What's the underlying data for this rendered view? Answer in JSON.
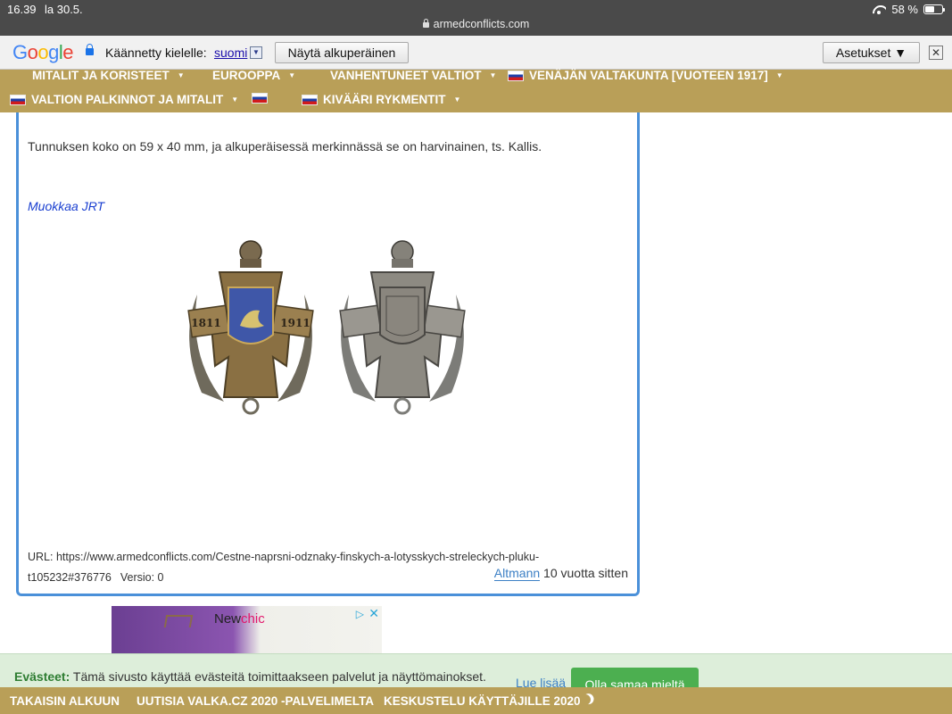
{
  "status_bar": {
    "time": "16.39",
    "date": "la 30.5.",
    "url": "armedconflicts.com",
    "battery_text": "58 %",
    "battery_level": 0.58
  },
  "translate_bar": {
    "logo": "Google",
    "translated_label": "Käännetty kielelle:",
    "language": "suomi",
    "language_arrow": "▼",
    "show_original": "Näytä alkuperäinen",
    "settings": "Asetukset ▼",
    "close": "✕"
  },
  "nav": {
    "items": [
      {
        "label": "MITALIT JA KORISTEET",
        "caret": "▼"
      },
      {
        "label": "EUROOPPA",
        "caret": "▼"
      },
      {
        "label": "VANHENTUNEET VALTIOT",
        "caret": "▼"
      },
      {
        "label": "VENÄJÄN VALTAKUNTA [VUOTEEN 1917]",
        "caret": "▼"
      },
      {
        "label": "VALTION PALKINNOT JA MITALIT",
        "caret": "▼"
      },
      {
        "label": "",
        "caret": ""
      },
      {
        "label": "KIVÄÄRI RYKMENTIT",
        "caret": "▼"
      }
    ]
  },
  "content": {
    "description": "Tunnuksen koko on 59 x 40 mm, ja alkuperäisessä merkinnässä se on harvinainen, ts. Kallis.",
    "edit_link": "Muokkaa JRT",
    "badge_years": {
      "left": "1811",
      "right": "1911"
    },
    "url_line": "URL: https://www.armedconflicts.com/Cestne-naprsni-odznaky-finskych-a-lotysskych-streleckych-pluku-t105232#376776",
    "version": "Versio: 0",
    "author": "Altmann",
    "time_ago": "10 vuotta sitten"
  },
  "ad": {
    "brand_prefix": "New",
    "brand_suffix": "chic",
    "adchoices": "▷",
    "close": "✕"
  },
  "cookie": {
    "title": "Evästeet:",
    "text": "Tämä sivusto käyttää evästeitä toimittaakseen palvelut ja näyttömainokset.",
    "more": "Lue lisää",
    "agree": "Olla samaa mieltä"
  },
  "footer": {
    "items": [
      "TAKAISIN ALKUUN",
      "UUTISIA VALKA.CZ 2020 -PALVELIMELTA",
      "KESKUSTELU KÄYTTÄJILLE 2020"
    ]
  }
}
